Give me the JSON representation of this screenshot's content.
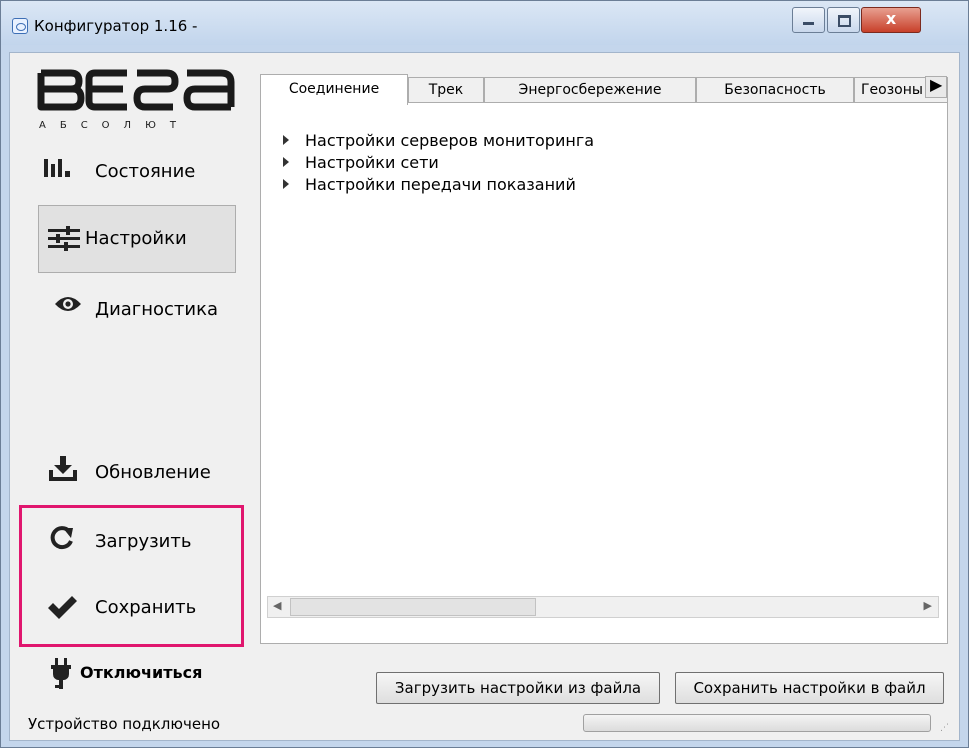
{
  "window": {
    "title": "Конфигуратор 1.16 -",
    "close_symbol": "x"
  },
  "logo": {
    "word": "ВЕГА",
    "sub": "АБСОЛЮТ"
  },
  "sidebar": {
    "items": [
      {
        "label": "Состояние",
        "icon": "bar-chart-icon"
      },
      {
        "label": "Настройки",
        "icon": "sliders-icon",
        "selected": true
      },
      {
        "label": "Диагностика",
        "icon": "eye-icon"
      },
      {
        "label": "Обновление",
        "icon": "download-icon"
      },
      {
        "label": "Загрузить",
        "icon": "refresh-icon"
      },
      {
        "label": "Сохранить",
        "icon": "checkmark-icon"
      },
      {
        "label": "Отключиться",
        "icon": "plug-icon"
      }
    ],
    "highlight_color": "#e0166e"
  },
  "tabs": [
    {
      "label": "Соединение",
      "active": true
    },
    {
      "label": "Трек"
    },
    {
      "label": "Энергосбережение"
    },
    {
      "label": "Безопасность"
    },
    {
      "label": "Геозоны"
    }
  ],
  "tree": [
    {
      "label": "Настройки серверов мониторинга"
    },
    {
      "label": "Настройки сети"
    },
    {
      "label": "Настройки передачи показаний"
    }
  ],
  "buttons": {
    "load_file": "Загрузить настройки из файла",
    "save_file": "Сохранить настройки в файл"
  },
  "status": {
    "text": "Устройство подключено"
  }
}
